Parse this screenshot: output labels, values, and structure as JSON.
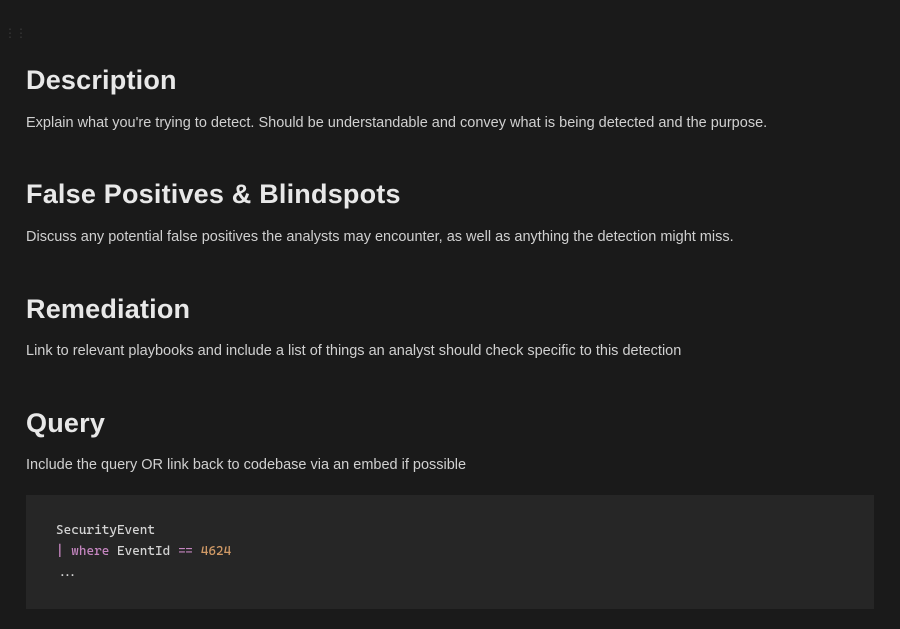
{
  "sections": {
    "description": {
      "heading": "Description",
      "body": "Explain what you're trying to detect. Should be understandable and convey what is being detected and the purpose."
    },
    "falsePositives": {
      "heading": "False Positives & Blindspots",
      "body": "Discuss any potential false positives the analysts may encounter, as well as anything the detection might miss."
    },
    "remediation": {
      "heading": "Remediation",
      "body": "Link to relevant playbooks and include a list of things an analyst should check specific to this detection"
    },
    "query": {
      "heading": "Query",
      "body": "Include the query OR link back to codebase via an embed if possible",
      "code": {
        "line1_identifier": "SecurityEvent",
        "line2_pipe": "|",
        "line2_keyword": " where ",
        "line2_field": "EventId ",
        "line2_operator": "==",
        "line2_number": " 4624",
        "line3": "..."
      }
    }
  }
}
